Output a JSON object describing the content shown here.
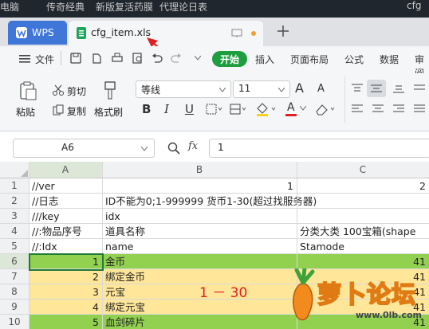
{
  "desktop_strip": {
    "text_left": "电脑",
    "text_mid": "传奇经典",
    "text_mid2": "新版复活药膜",
    "text_right": "代理论日表",
    "text_far": "cfg"
  },
  "tabs": {
    "app": "WPS",
    "file": "cfg_item.xls"
  },
  "menu": {
    "file": "文件",
    "start": "开始",
    "insert": "插入",
    "layout": "页面布局",
    "formula": "公式",
    "data": "数据",
    "review": "审阅"
  },
  "ribbon": {
    "paste": "粘贴",
    "cut": "剪切",
    "copy": "复制",
    "format_painter": "格式刷",
    "font_name": "等线",
    "font_size": "11",
    "bold": "B",
    "italic": "I",
    "underline": "U",
    "font_color_letter": "A",
    "grow_font": "A",
    "shrink_font": "A"
  },
  "formula_bar": {
    "cell_ref": "A6",
    "fx": "fx",
    "value": "1"
  },
  "columns": [
    "A",
    "B",
    "C"
  ],
  "rows": [
    {
      "n": "1",
      "a": "//ver",
      "b": "1",
      "c": "2",
      "hl": "none"
    },
    {
      "n": "2",
      "a": "//日志",
      "b": "ID不能为0;1-999999 货币1-30(超过找服务器)",
      "c": "",
      "hl": "none"
    },
    {
      "n": "3",
      "a": "///key",
      "b": "idx",
      "c": "",
      "hl": "none"
    },
    {
      "n": "4",
      "a": "//:物品序号",
      "b": "道具名称",
      "c": "分类大类 100宝箱(shape",
      "hl": "none"
    },
    {
      "n": "5",
      "a": "//:Idx",
      "b": "name",
      "c": "Stamode",
      "hl": "none"
    },
    {
      "n": "6",
      "a": "1",
      "b": "金币",
      "c": "41",
      "hl": "green"
    },
    {
      "n": "7",
      "a": "2",
      "b": "绑定金币",
      "c": "41",
      "hl": "yellow"
    },
    {
      "n": "8",
      "a": "3",
      "b": "元宝",
      "c": "41",
      "hl": "yellow"
    },
    {
      "n": "9",
      "a": "4",
      "b": "绑定元宝",
      "c": "41",
      "hl": "yellow"
    },
    {
      "n": "10",
      "a": "5",
      "b": "血剑碎片",
      "c": "41",
      "hl": "green"
    }
  ],
  "annotation": "1 － 30",
  "watermark": {
    "text": "萝卜论坛",
    "url": "www.0lb.com"
  },
  "colors": {
    "green": "#92d050",
    "yellow": "#ffe699",
    "accent": "#1e9e3e",
    "annotation": "#e02020"
  }
}
